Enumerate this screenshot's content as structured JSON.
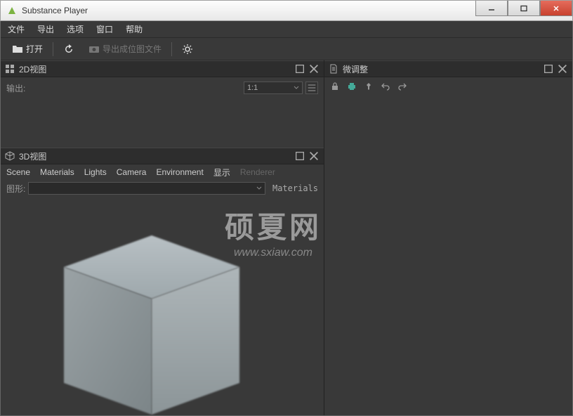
{
  "window": {
    "title": "Substance Player"
  },
  "menu": {
    "file": "文件",
    "export": "导出",
    "options": "选项",
    "window": "窗口",
    "help": "帮助"
  },
  "toolbar": {
    "open": "打开",
    "export_bitmap": "导出成位图文件"
  },
  "panels": {
    "view2d": {
      "title": "2D视图",
      "output": "输出:",
      "ratio": "1:1"
    },
    "view3d": {
      "title": "3D视图",
      "tabs": {
        "scene": "Scene",
        "materials": "Materials",
        "lights": "Lights",
        "camera": "Camera",
        "environment": "Environment",
        "display": "显示",
        "renderer": "Renderer"
      },
      "shape_label": "图形:",
      "materials_btn": "Materials"
    },
    "tweaks": {
      "title": "微调整"
    }
  },
  "watermark": {
    "big": "硕夏网",
    "small": "www.sxiaw.com"
  }
}
